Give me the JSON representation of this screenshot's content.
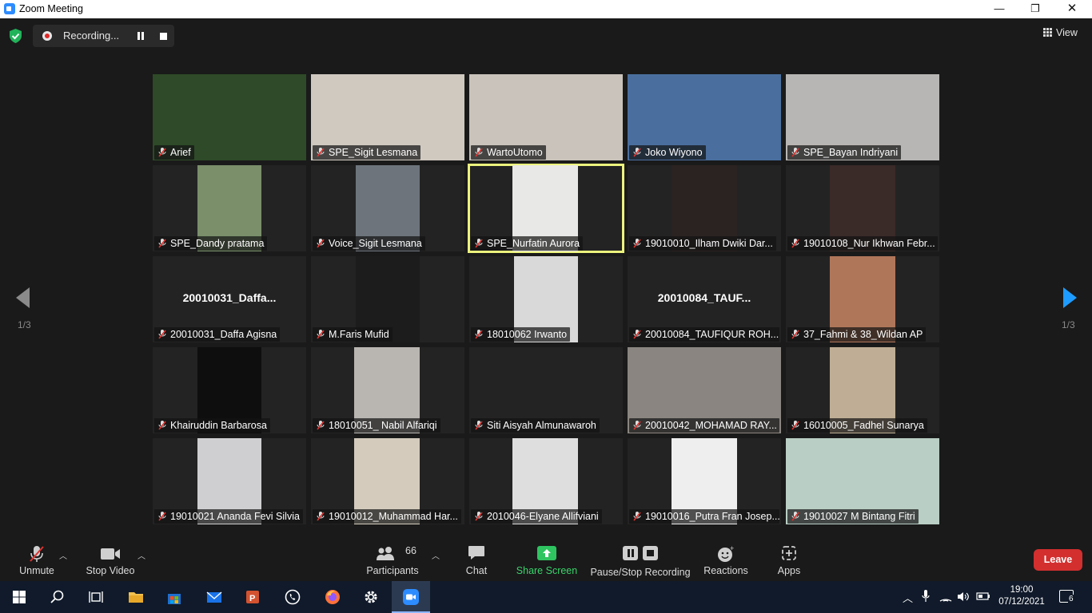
{
  "window": {
    "title": "Zoom Meeting",
    "minimize": "—",
    "maximize": "❐",
    "close": "✕"
  },
  "topbar": {
    "recording_label": "Recording...",
    "view_label": "View"
  },
  "pagination": {
    "left": "1/3",
    "right": "1/3"
  },
  "tiles": [
    {
      "name": "Arief",
      "bg": "#2e4a28"
    },
    {
      "name": "SPE_Sigit Lesmana",
      "bg": "#cfc9c0"
    },
    {
      "name": "WartoUtomo",
      "bg": "#c9c3bb"
    },
    {
      "name": "Joko Wiyono",
      "bg": "#4a6f9e"
    },
    {
      "name": "SPE_Bayan Indriyani",
      "bg": "#b8b6b4"
    },
    {
      "name": "SPE_Dandy pratama",
      "bg": "#7a8f6a"
    },
    {
      "name": "Voice_Sigit Lesmana",
      "bg": "#6d747c"
    },
    {
      "name": "SPE_Nurfatin Aurora",
      "bg": "#e8e8e6"
    },
    {
      "name": "19010010_Ilham Dwiki Dar...",
      "bg": "#2b2322"
    },
    {
      "name": "19010108_Nur Ikhwan Febr...",
      "bg": "#3a2a28"
    },
    {
      "name": "20010031_Daffa Agisna",
      "big": "20010031_Daffa..."
    },
    {
      "name": "M.Faris Mufid",
      "bg": "#1c1c1c"
    },
    {
      "name": "18010062 Irwanto",
      "bg": "#d9d9d9"
    },
    {
      "name": "20010084_TAUFIQUR ROH...",
      "big": "20010084_TAUF..."
    },
    {
      "name": "37_Fahmi & 38_Wildan AP",
      "bg": "#b0765a"
    },
    {
      "name": "Khairuddin Barbarosa",
      "bg": "#0e0e0e"
    },
    {
      "name": "18010051_ Nabil Alfariqi",
      "bg": "#b9b6b2"
    },
    {
      "name": "Siti Aisyah Almunawaroh"
    },
    {
      "name": "20010042_MOHAMAD RAY...",
      "bg": "#8a8580"
    },
    {
      "name": "16010005_Fadhel Sunarya",
      "bg": "#bfae95"
    },
    {
      "name": "19010021 Ananda Fevi Silvia",
      "bg": "#cfcfd1"
    },
    {
      "name": "19010012_Muhammad Har...",
      "bg": "#d4cbbd"
    },
    {
      "name": "2010046-Elyane Allifviani",
      "bg": "#dedede"
    },
    {
      "name": "19010016_Putra Fran Josep...",
      "bg": "#eeeeee"
    },
    {
      "name": "19010027 M Bintang Fitri",
      "bg": "#b9cec4"
    }
  ],
  "toolbar": {
    "unmute": "Unmute",
    "stop_video": "Stop Video",
    "participants": "Participants",
    "participants_count": "66",
    "chat": "Chat",
    "share_screen": "Share Screen",
    "pause_stop_recording": "Pause/Stop Recording",
    "reactions": "Reactions",
    "apps": "Apps",
    "leave": "Leave"
  },
  "taskbar": {
    "time": "19:00",
    "date": "07/12/2021",
    "notifications": "6"
  },
  "colors": {
    "accent_blue": "#1e9bff",
    "share_green": "#3ad46b",
    "leave_red": "#d32f2f",
    "speaker_outline": "#ecf37d"
  }
}
